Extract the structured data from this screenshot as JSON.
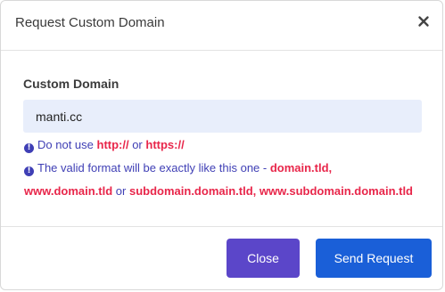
{
  "modal": {
    "title": "Request Custom Domain",
    "close_icon": "close-icon"
  },
  "form": {
    "label": "Custom Domain",
    "value": "manti.cc"
  },
  "hints": {
    "line1": {
      "icon": "info-icon",
      "text_a": "Do not use ",
      "red_a": "http://",
      "text_b": " or ",
      "red_b": "https://"
    },
    "line2": {
      "icon": "info-icon",
      "text_a": "The valid format will be exactly like this one - ",
      "red_a": "domain.tld,"
    },
    "line3": {
      "red_a": "www.domain.tld",
      "text_a": " or ",
      "red_b": "subdomain.domain.tld, www.subdomain.domain.tld"
    }
  },
  "footer": {
    "close_label": "Close",
    "send_label": "Send Request"
  },
  "colors": {
    "primary": "#1a5fd8",
    "secondary": "#5b46c9",
    "hint_text": "#3f3fb5",
    "highlight": "#e8264a",
    "input_bg": "#e8eefb"
  }
}
